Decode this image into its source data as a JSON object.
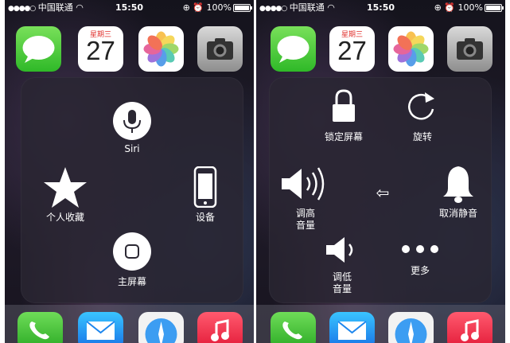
{
  "status_bar": {
    "carrier_dots": "●●●●○",
    "carrier": "中国联通",
    "time": "15:50",
    "battery_percent": "100%"
  },
  "home_screen": {
    "calendar_weekday": "星期三",
    "calendar_date": "27"
  },
  "left_panel": {
    "siri": "Siri",
    "favorites": "个人收藏",
    "device": "设备",
    "home": "主屏幕"
  },
  "right_panel": {
    "lock_screen": "锁定屏幕",
    "rotate": "旋转",
    "volume_up_line1": "调高",
    "volume_up_line2": "音量",
    "back_arrow": "⇦",
    "mute": "取消静音",
    "volume_down_line1": "调低",
    "volume_down_line2": "音量",
    "more": "更多"
  },
  "colors": {
    "overlay": "#2a2632",
    "calendar_red": "#e0302c"
  }
}
